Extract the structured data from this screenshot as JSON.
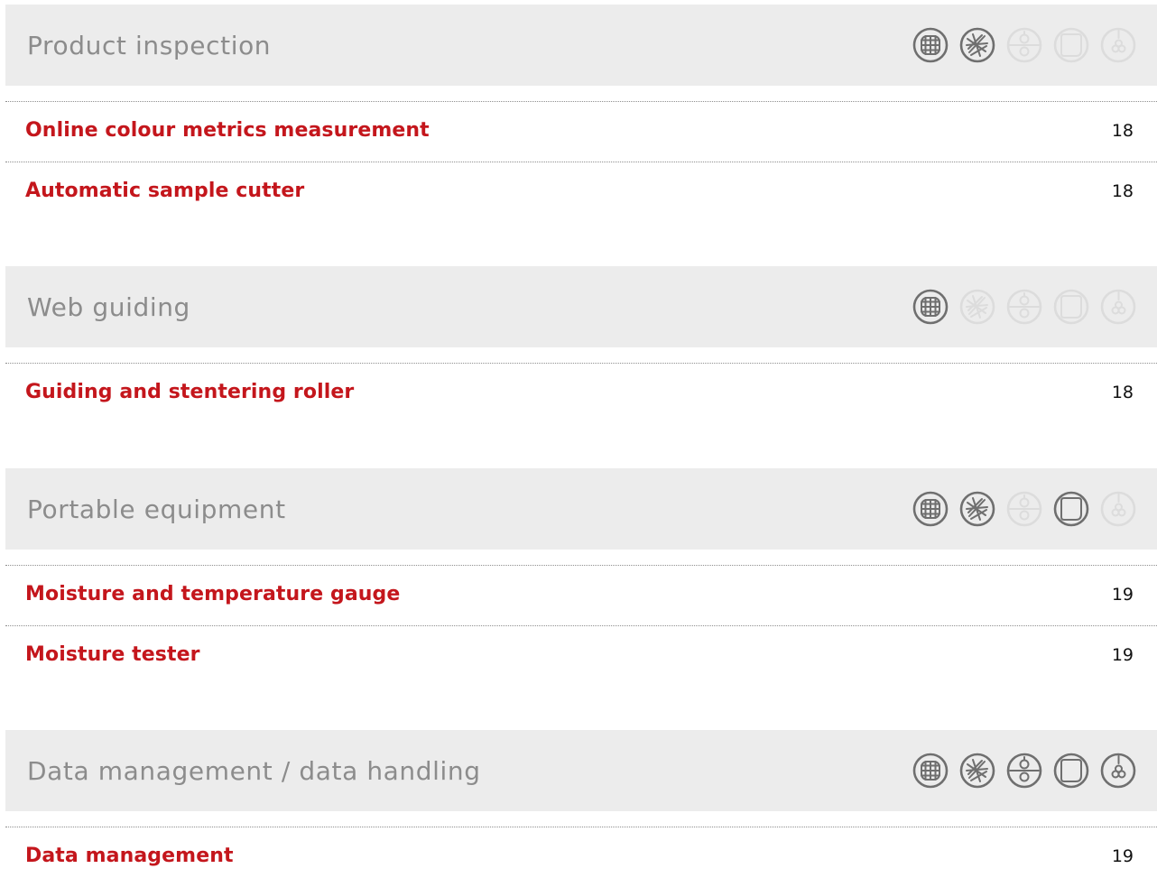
{
  "colors": {
    "accent_red": "#c4161c",
    "header_bg": "#ececec",
    "header_text": "#8c8c8c",
    "icon_dark": "#6f6f6f",
    "icon_light": "#dcdcdc"
  },
  "icon_names": [
    "woven-fabric-icon",
    "nonwoven-fabric-icon",
    "coating-roller-icon",
    "film-sheet-icon",
    "yarn-spool-icon"
  ],
  "sections": [
    {
      "title": "Product inspection",
      "icon_states": [
        "dark",
        "dark",
        "light",
        "light",
        "light"
      ],
      "items": [
        {
          "label": "Online colour metrics measurement",
          "page": "18"
        },
        {
          "label": "Automatic sample cutter",
          "page": "18"
        }
      ]
    },
    {
      "title": "Web guiding",
      "icon_states": [
        "dark",
        "light",
        "light",
        "light",
        "light"
      ],
      "items": [
        {
          "label": "Guiding and stentering roller",
          "page": "18"
        }
      ]
    },
    {
      "title": "Portable equipment",
      "icon_states": [
        "dark",
        "dark",
        "light",
        "dark",
        "light"
      ],
      "items": [
        {
          "label": "Moisture and temperature gauge",
          "page": "19"
        },
        {
          "label": "Moisture tester",
          "page": "19"
        }
      ]
    },
    {
      "title": "Data management / data handling",
      "icon_states": [
        "dark",
        "dark",
        "dark",
        "dark",
        "dark"
      ],
      "items": [
        {
          "label": "Data management",
          "page": "19"
        }
      ]
    }
  ]
}
